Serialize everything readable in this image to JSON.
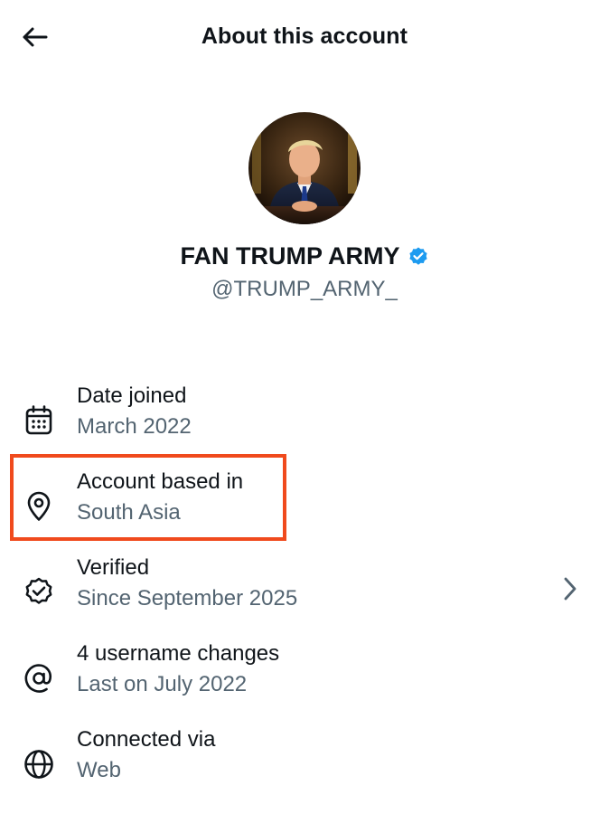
{
  "header": {
    "title": "About this account",
    "back_icon": "arrow-left-icon"
  },
  "profile": {
    "name": "FAN TRUMP ARMY",
    "handle": "@TRUMP_ARMY_",
    "verified": true,
    "badge_color": "#1d9bf0"
  },
  "rows": [
    {
      "title": "Date joined",
      "value": "March 2022",
      "icon": "calendar-icon"
    },
    {
      "title": "Account based in",
      "value": "South Asia",
      "icon": "location-pin-icon",
      "highlighted": true
    },
    {
      "title": "Verified",
      "value": "Since September 2025",
      "icon": "verified-seal-icon",
      "has_chevron": true
    },
    {
      "title": "4 username changes",
      "value": "Last on July 2022",
      "icon": "at-sign-icon"
    },
    {
      "title": "Connected via",
      "value": "Web",
      "icon": "globe-icon"
    }
  ],
  "colors": {
    "primary_text": "#0f1419",
    "secondary_text": "#536471",
    "highlight": "#f04a1d",
    "verified_badge": "#1d9bf0"
  }
}
